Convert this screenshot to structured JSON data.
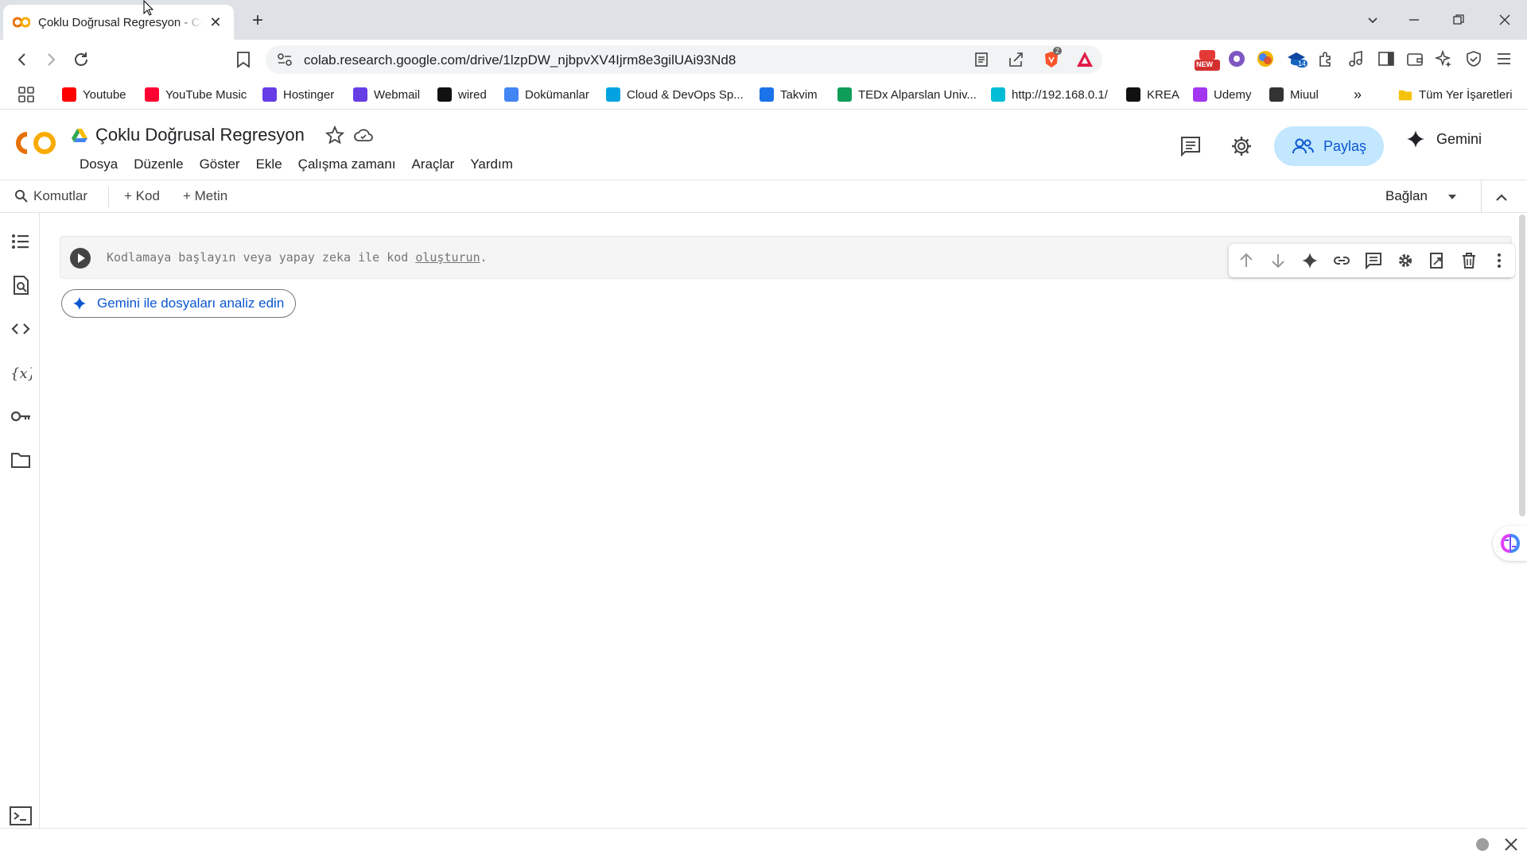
{
  "browser": {
    "tab_title": "Çoklu Doğrusal Regresyon - Colab",
    "url": "colab.research.google.com/drive/1lzpDW_njbpvXV4Ijrm8e3gilUAi93Nd8",
    "brave_badge": "2",
    "ext_badge_new": "NEW",
    "ext_badge_count": "14"
  },
  "bookmarks": [
    {
      "label": "Youtube",
      "color": "#ff0000"
    },
    {
      "label": "YouTube Music",
      "color": "#ff0033"
    },
    {
      "label": "Hostinger",
      "color": "#673de6"
    },
    {
      "label": "Webmail",
      "color": "#673de6"
    },
    {
      "label": "wired",
      "color": "#111111"
    },
    {
      "label": "Dokümanlar",
      "color": "#4285f4"
    },
    {
      "label": "Cloud & DevOps Sp...",
      "color": "#00a3e0"
    },
    {
      "label": "Takvim",
      "color": "#1a73e8"
    },
    {
      "label": "TEDx Alparslan Univ...",
      "color": "#0f9d58"
    },
    {
      "label": "http://192.168.0.1/",
      "color": "#00bcd4"
    },
    {
      "label": "KREA",
      "color": "#111111"
    },
    {
      "label": "Udemy",
      "color": "#a435f0"
    },
    {
      "label": "Miuul",
      "color": "#333333"
    }
  ],
  "bookmarks_overflow": "»",
  "all_bookmarks": "Tüm Yer İşaretleri",
  "colab": {
    "doc_title": "Çoklu Doğrusal Regresyon",
    "menu": [
      "Dosya",
      "Düzenle",
      "Göster",
      "Ekle",
      "Çalışma zamanı",
      "Araçlar",
      "Yardım"
    ],
    "share_label": "Paylaş",
    "gemini_label": "Gemini",
    "commands_label": "Komutlar",
    "add_code_label": "+ Kod",
    "add_text_label": "+ Metin",
    "connect_label": "Bağlan",
    "cell_placeholder_prefix": "Kodlamaya başlayın veya yapay zeka ile kod ",
    "cell_placeholder_link": "oluşturun",
    "cell_placeholder_suffix": ".",
    "gemini_analyze_label": "Gemini ile dosyaları analiz edin"
  },
  "colors": {
    "accent": "#0b57d0",
    "share_bg": "#c2e7ff",
    "colab_orange": "#f9ab00",
    "colab_orange_dark": "#e8710a"
  }
}
